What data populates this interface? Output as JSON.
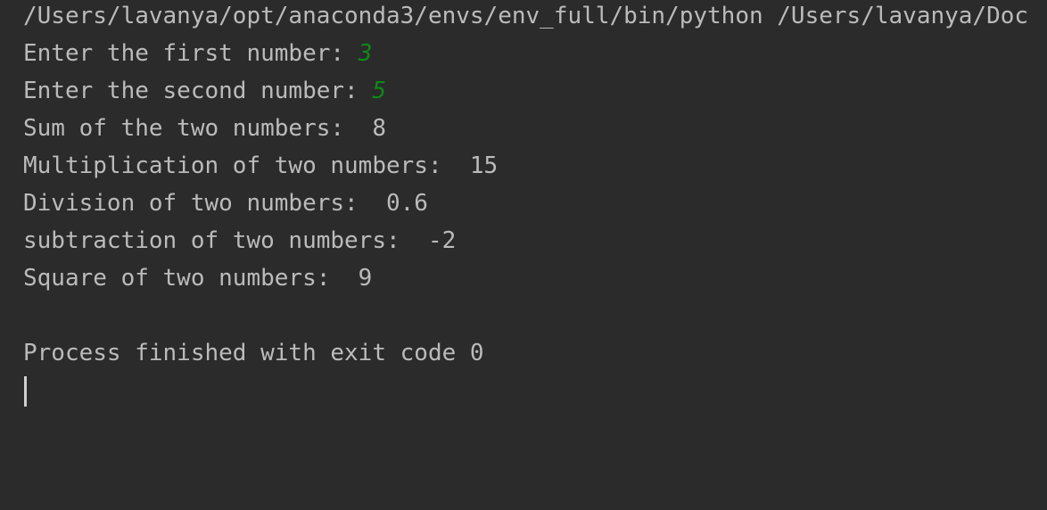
{
  "console": {
    "command_line": "/Users/lavanya/opt/anaconda3/envs/env_full/bin/python /Users/lavanya/Doc",
    "prompt_first": "Enter the first number: ",
    "input_first": "3",
    "prompt_second": "Enter the second number: ",
    "input_second": "5",
    "sum_line": "Sum of the two numbers:  8",
    "mult_line": "Multiplication of two numbers:  15",
    "div_line": "Division of two numbers:  0.6",
    "sub_line": "subtraction of two numbers:  -2",
    "square_line": "Square of two numbers:  9",
    "exit_line": "Process finished with exit code 0"
  },
  "colors": {
    "background": "#2b2b2b",
    "text": "#bbbbbb",
    "user_input": "#0e8a16"
  }
}
